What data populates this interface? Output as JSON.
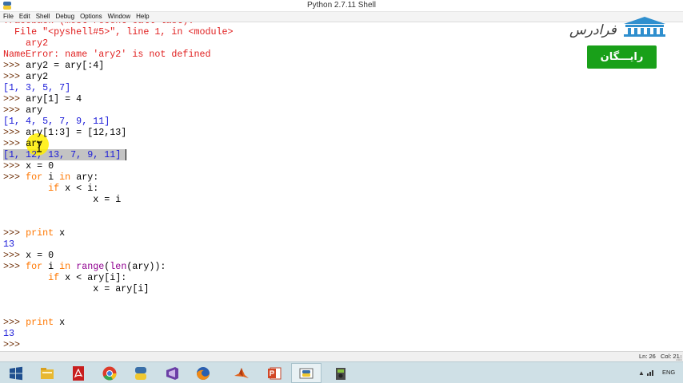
{
  "window": {
    "title": "Python 2.7.11 Shell"
  },
  "menu": [
    "File",
    "Edit",
    "Shell",
    "Debug",
    "Options",
    "Window",
    "Help"
  ],
  "logo": {
    "text": "فرادرس",
    "badge": "رایـــگان"
  },
  "code_lines": [
    [
      {
        "t": "Traceback (most recent call last):",
        "c": "red"
      }
    ],
    [
      {
        "t": "  File \"<pyshell#5>\", line 1, in <module>",
        "c": "red"
      }
    ],
    [
      {
        "t": "    ary2",
        "c": "red"
      }
    ],
    [
      {
        "t": "NameError: name 'ary2' is not defined",
        "c": "red"
      }
    ],
    [
      {
        "t": ">>> ",
        "c": "prompt"
      },
      {
        "t": "ary2 = ary[:4]",
        "c": "black"
      }
    ],
    [
      {
        "t": ">>> ",
        "c": "prompt"
      },
      {
        "t": "ary2",
        "c": "black"
      }
    ],
    [
      {
        "t": "[1, 3, 5, 7]",
        "c": "blue"
      }
    ],
    [
      {
        "t": ">>> ",
        "c": "prompt"
      },
      {
        "t": "ary[1] = 4",
        "c": "black"
      }
    ],
    [
      {
        "t": ">>> ",
        "c": "prompt"
      },
      {
        "t": "ary",
        "c": "black"
      }
    ],
    [
      {
        "t": "[1, 4, 5, 7, 9, 11]",
        "c": "blue"
      }
    ],
    [
      {
        "t": ">>> ",
        "c": "prompt"
      },
      {
        "t": "ary[1:3] = [12,13]",
        "c": "black"
      }
    ],
    [
      {
        "t": ">>> ",
        "c": "prompt"
      },
      {
        "t": "ary",
        "c": "black"
      }
    ],
    [
      {
        "t": "[1, 12, 13, 7, 9, 11]",
        "c": "blue"
      }
    ],
    [
      {
        "t": ">>> ",
        "c": "prompt"
      },
      {
        "t": "x = 0",
        "c": "black"
      }
    ],
    [
      {
        "t": ">>> ",
        "c": "prompt"
      },
      {
        "t": "for",
        "c": "kw"
      },
      {
        "t": " i ",
        "c": "black"
      },
      {
        "t": "in",
        "c": "kw"
      },
      {
        "t": " ary:",
        "c": "black"
      }
    ],
    [
      {
        "t": "        ",
        "c": "black"
      },
      {
        "t": "if",
        "c": "kw"
      },
      {
        "t": " x < i:",
        "c": "black"
      }
    ],
    [
      {
        "t": "                x = i",
        "c": "black"
      }
    ],
    [],
    [],
    [
      {
        "t": ">>> ",
        "c": "prompt"
      },
      {
        "t": "print",
        "c": "kw"
      },
      {
        "t": " x",
        "c": "black"
      }
    ],
    [
      {
        "t": "13",
        "c": "blue"
      }
    ],
    [
      {
        "t": ">>> ",
        "c": "prompt"
      },
      {
        "t": "x = 0",
        "c": "black"
      }
    ],
    [
      {
        "t": ">>> ",
        "c": "prompt"
      },
      {
        "t": "for",
        "c": "kw"
      },
      {
        "t": " i ",
        "c": "black"
      },
      {
        "t": "in",
        "c": "kw"
      },
      {
        "t": " ",
        "c": "black"
      },
      {
        "t": "range",
        "c": "bi"
      },
      {
        "t": "(",
        "c": "black"
      },
      {
        "t": "len",
        "c": "bi"
      },
      {
        "t": "(ary)):",
        "c": "black"
      }
    ],
    [
      {
        "t": "        ",
        "c": "black"
      },
      {
        "t": "if",
        "c": "kw"
      },
      {
        "t": " x < ary[i]:",
        "c": "black"
      }
    ],
    [
      {
        "t": "                x = ary[i]",
        "c": "black"
      }
    ],
    [],
    [],
    [
      {
        "t": ">>> ",
        "c": "prompt"
      },
      {
        "t": "print",
        "c": "kw"
      },
      {
        "t": " x",
        "c": "black"
      }
    ],
    [
      {
        "t": "13",
        "c": "blue"
      }
    ],
    [
      {
        "t": ">>> ",
        "c": "prompt"
      }
    ]
  ],
  "status": {
    "ln": "Ln: 26",
    "col": "Col: 21"
  },
  "taskbar": {
    "apps": [
      "start-icon",
      "file-explorer-icon",
      "acrobat-icon",
      "chrome-icon",
      "python-icon",
      "visual-studio-icon",
      "firefox-icon",
      "matlab-icon",
      "powerpoint-icon",
      "python-idle-icon",
      "camera-app-icon"
    ],
    "active_app": "python-idle-icon",
    "lang": "ENG"
  },
  "colors": {
    "red": "#e02020",
    "blue": "#1a1ad8",
    "keyword": "#ff7700",
    "builtin": "#900090",
    "selection": "#c3c3c3",
    "badge": "#19a019"
  }
}
